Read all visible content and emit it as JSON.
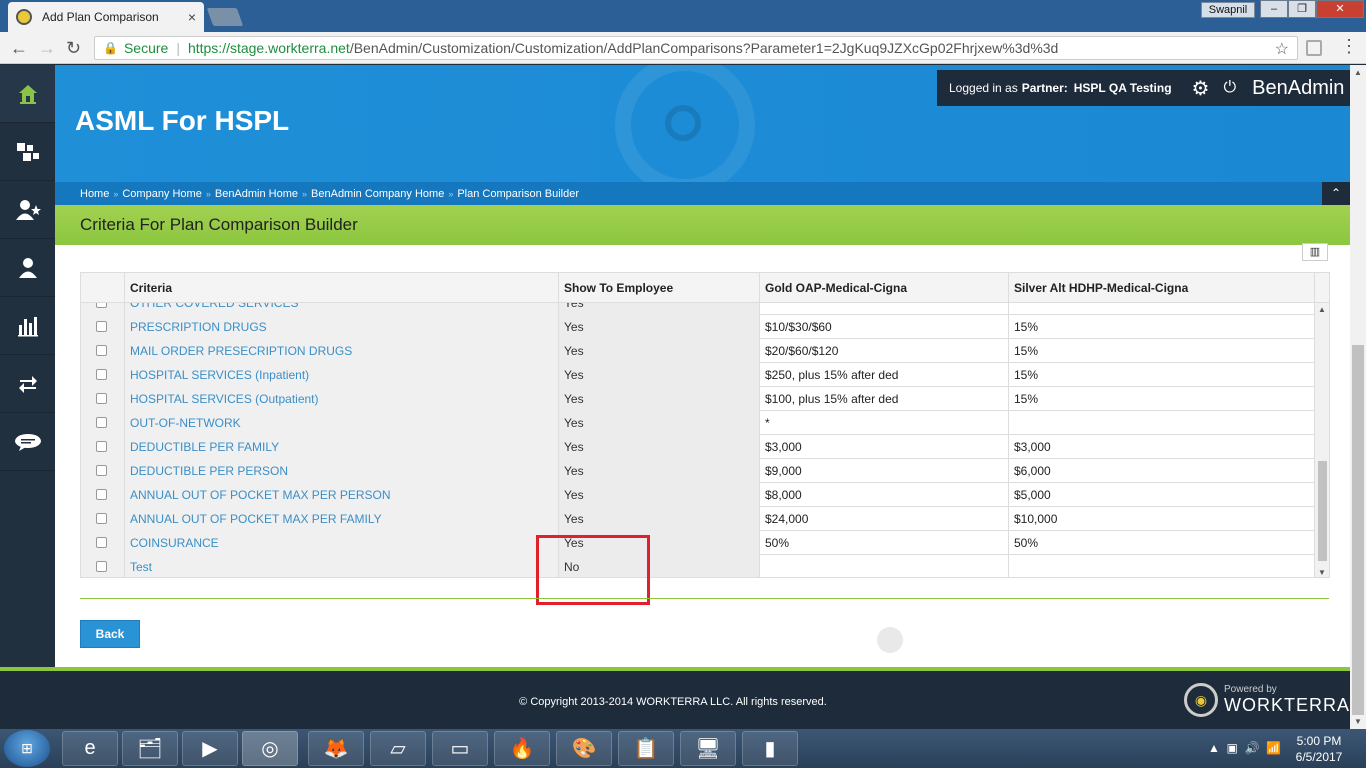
{
  "browser": {
    "tab_title": "Add Plan Comparison",
    "tab_close": "×",
    "user_chip": "Swapnil",
    "win_min": "–",
    "win_max": "❐",
    "win_close": "✕",
    "secure_label": "Secure",
    "url_host": "https://stage.workterra.net",
    "url_path": "/BenAdmin/Customization/Customization/AddPlanComparisons?Parameter1=2JgKuq9JZXcGp02Fhrjxew%3d%3d"
  },
  "sidebar": {
    "items": [
      {
        "name": "home-icon",
        "glyph": "⌂"
      },
      {
        "name": "puzzle-icon",
        "glyph": "✣"
      },
      {
        "name": "user-star-icon",
        "glyph": "👤"
      },
      {
        "name": "user-icon",
        "glyph": "👤"
      },
      {
        "name": "bar-chart-icon",
        "glyph": "▮"
      },
      {
        "name": "transfer-icon",
        "glyph": "⇄"
      },
      {
        "name": "chat-icon",
        "glyph": "💬"
      }
    ]
  },
  "header": {
    "company_name": "ASML For HSPL",
    "logged_in_prefix": "Logged in as",
    "partner_label": "Partner:",
    "partner_name": "HSPL QA Testing",
    "app_name": "BenAdmin"
  },
  "breadcrumb": [
    "Home",
    "Company Home",
    "BenAdmin Home",
    "BenAdmin Company Home",
    "Plan Comparison Builder"
  ],
  "section_title": "Criteria For Plan Comparison Builder",
  "table": {
    "headers": [
      "Criteria",
      "Show To Employee",
      "Gold OAP-Medical-Cigna",
      "Silver Alt HDHP-Medical-Cigna"
    ],
    "rows": [
      {
        "criteria": "OTHER COVERED SERVICES",
        "show": "Yes",
        "gold": "*",
        "silver": ""
      },
      {
        "criteria": "PRESCRIPTION DRUGS",
        "show": "Yes",
        "gold": "$10/$30/$60",
        "silver": "15%"
      },
      {
        "criteria": "MAIL ORDER PRESECRIPTION DRUGS",
        "show": "Yes",
        "gold": "$20/$60/$120",
        "silver": "15%"
      },
      {
        "criteria": "HOSPITAL SERVICES (Inpatient)",
        "show": "Yes",
        "gold": "$250, plus 15% after ded",
        "silver": "15%"
      },
      {
        "criteria": "HOSPITAL SERVICES (Outpatient)",
        "show": "Yes",
        "gold": "$100, plus 15% after ded",
        "silver": "15%"
      },
      {
        "criteria": "OUT-OF-NETWORK",
        "show": "Yes",
        "gold": "*",
        "silver": ""
      },
      {
        "criteria": "DEDUCTIBLE PER FAMILY",
        "show": "Yes",
        "gold": "$3,000",
        "silver": "$3,000"
      },
      {
        "criteria": "DEDUCTIBLE PER PERSON",
        "show": "Yes",
        "gold": "$9,000",
        "silver": "$6,000"
      },
      {
        "criteria": "ANNUAL OUT OF POCKET MAX PER PERSON",
        "show": "Yes",
        "gold": "$8,000",
        "silver": "$5,000"
      },
      {
        "criteria": "ANNUAL OUT OF POCKET MAX PER FAMILY",
        "show": "Yes",
        "gold": "$24,000",
        "silver": "$10,000"
      },
      {
        "criteria": "COINSURANCE",
        "show": "Yes",
        "gold": "50%",
        "silver": "50%"
      },
      {
        "criteria": "Test",
        "show": "No",
        "gold": "",
        "silver": ""
      }
    ]
  },
  "back_button": "Back",
  "footer": {
    "copyright": "© Copyright 2013-2014 WORKTERRA LLC. All rights reserved.",
    "powered_by": "Powered by",
    "brand": "WORKTERRA"
  },
  "taskbar": {
    "time": "5:00 PM",
    "date": "6/5/2017"
  },
  "colors": {
    "header_blue": "#1f8fd8",
    "section_green": "#8cc63f",
    "link_blue": "#3a8fc8",
    "highlight_red": "#e0202a"
  }
}
